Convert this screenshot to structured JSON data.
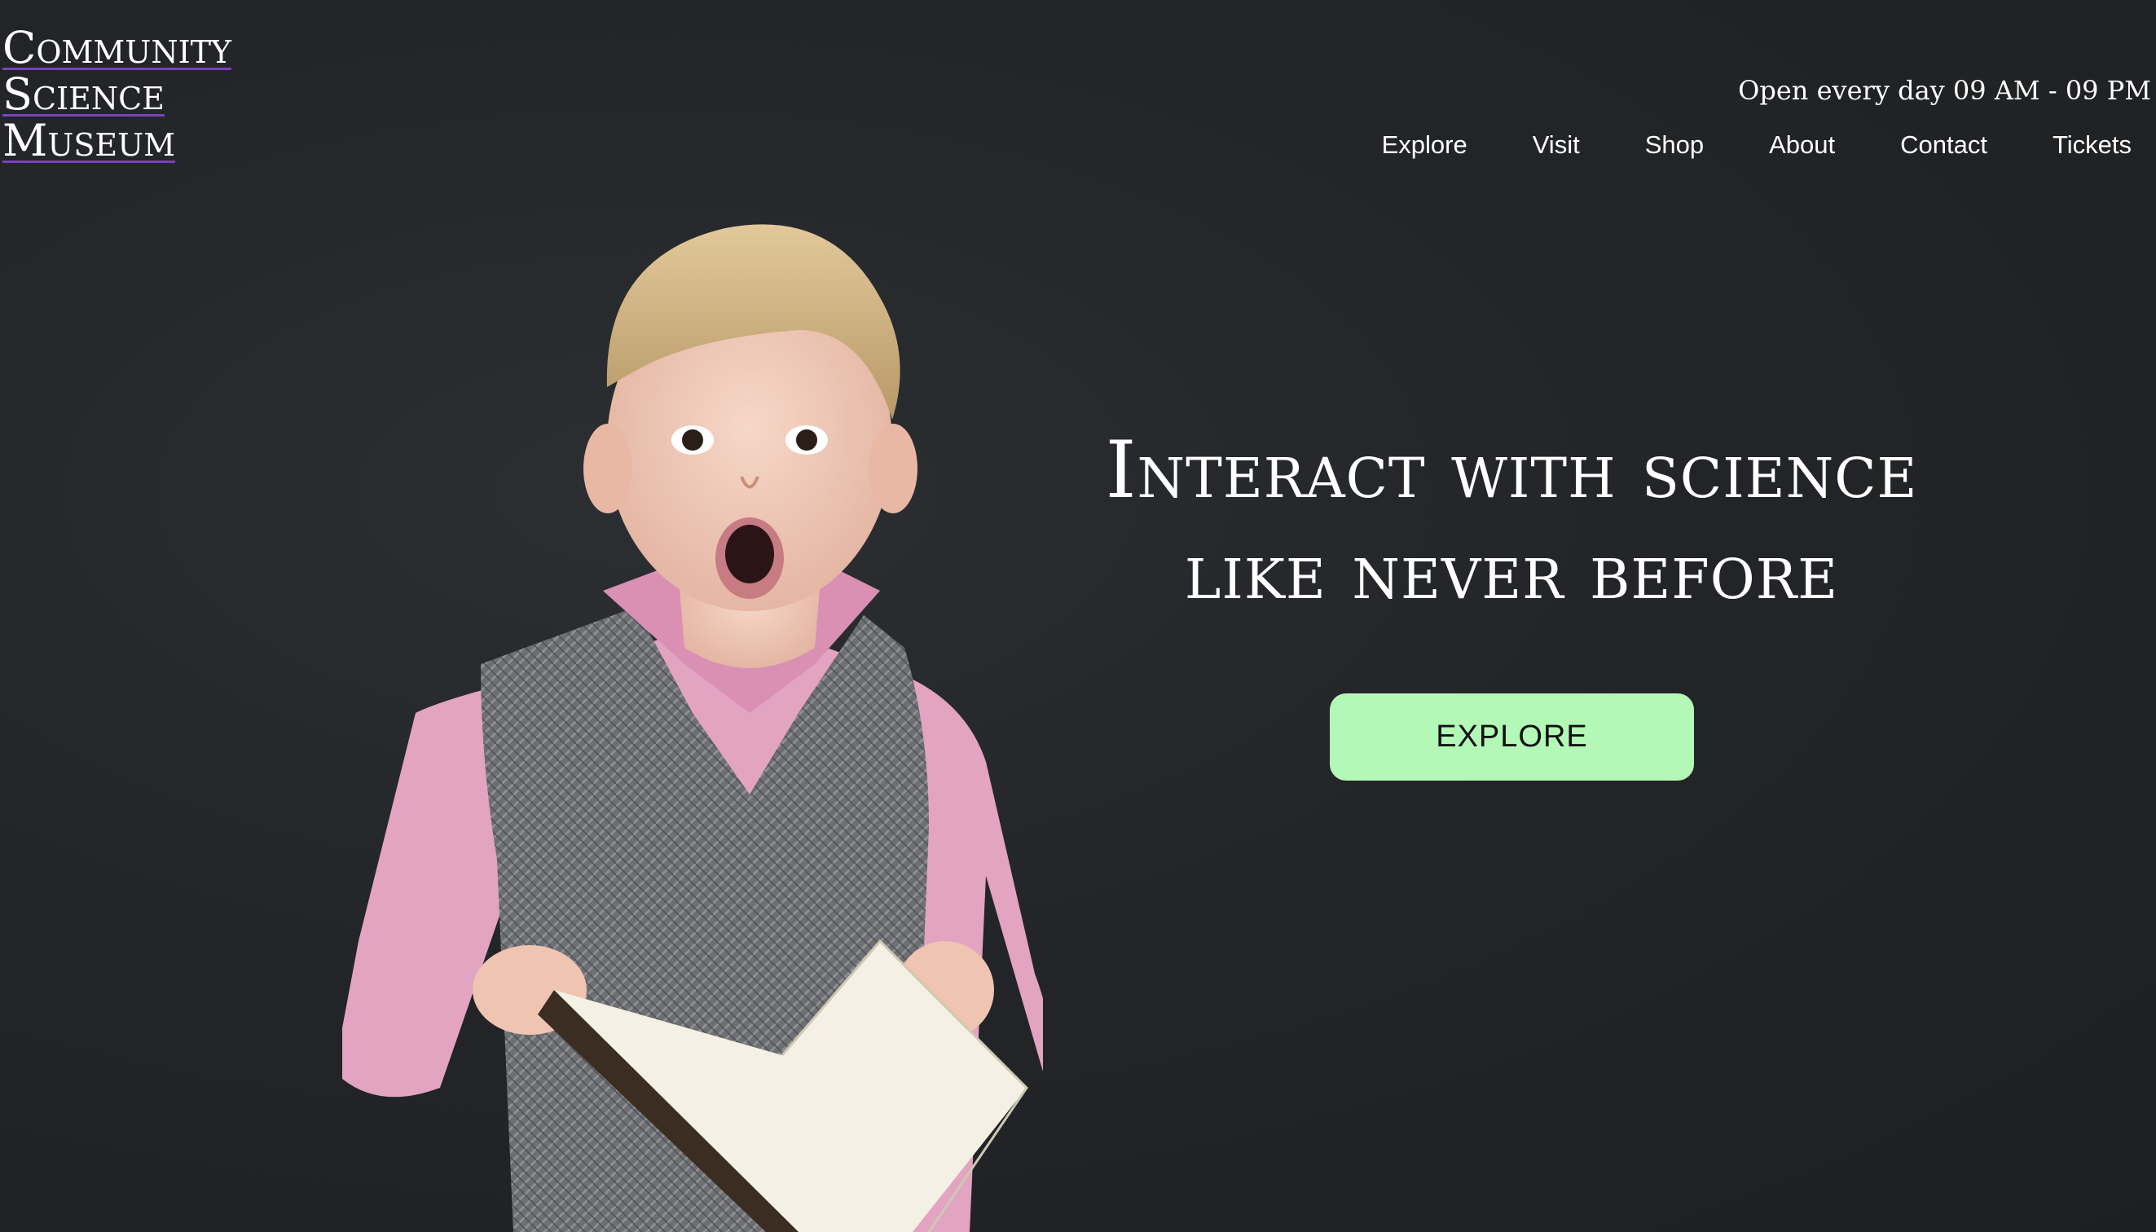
{
  "logo": {
    "line1": "Community",
    "line2": "Science",
    "line3": "Museum"
  },
  "header": {
    "hours": "Open every day 09 AM - 09 PM"
  },
  "nav": {
    "items": [
      {
        "label": "Explore"
      },
      {
        "label": "Visit"
      },
      {
        "label": "Shop"
      },
      {
        "label": "About"
      },
      {
        "label": "Contact"
      },
      {
        "label": "Tickets"
      }
    ]
  },
  "hero": {
    "headline_line1": "Interact with science",
    "headline_line2": "like never before",
    "cta_label": "EXPLORE",
    "cta_color": "#b3f8b7",
    "background_color": "#232528",
    "image": "surprised-child-holding-open-book"
  }
}
